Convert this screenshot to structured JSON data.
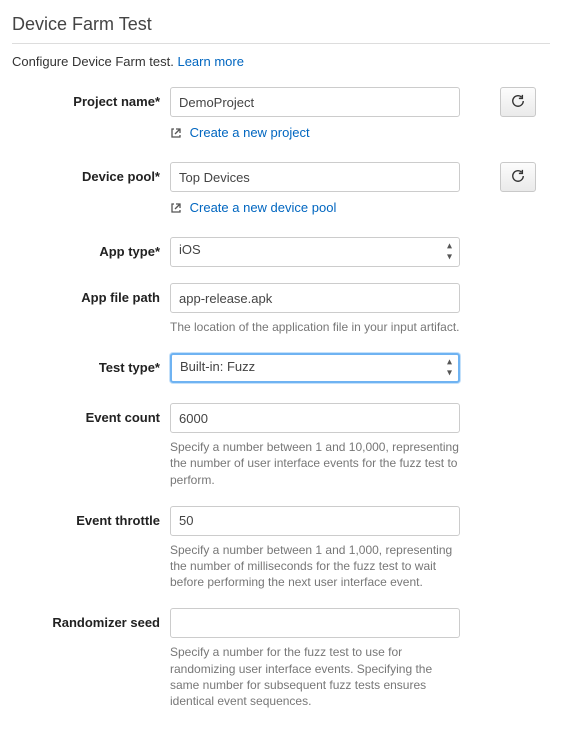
{
  "header": {
    "title": "Device Farm Test",
    "intro": "Configure Device Farm test.",
    "learn_more": "Learn more"
  },
  "fields": {
    "project_name": {
      "label": "Project name*",
      "value": "DemoProject",
      "create_link": "Create a new project"
    },
    "device_pool": {
      "label": "Device pool*",
      "value": "Top Devices",
      "create_link": "Create a new device pool"
    },
    "app_type": {
      "label": "App type*",
      "value": "iOS"
    },
    "app_file_path": {
      "label": "App file path",
      "value": "app-release.apk",
      "help": "The location of the application file in your input artifact."
    },
    "test_type": {
      "label": "Test type*",
      "value": "Built-in: Fuzz"
    },
    "event_count": {
      "label": "Event count",
      "value": "6000",
      "help": "Specify a number between 1 and 10,000, representing the number of user interface events for the fuzz test to perform."
    },
    "event_throttle": {
      "label": "Event throttle",
      "value": "50",
      "help": "Specify a number between 1 and 1,000, representing the number of milliseconds for the fuzz test to wait before performing the next user interface event."
    },
    "randomizer_seed": {
      "label": "Randomizer seed",
      "value": "",
      "help": "Specify a number for the fuzz test to use for randomizing user interface events. Specifying the same number for subsequent fuzz tests ensures identical event sequences."
    }
  }
}
